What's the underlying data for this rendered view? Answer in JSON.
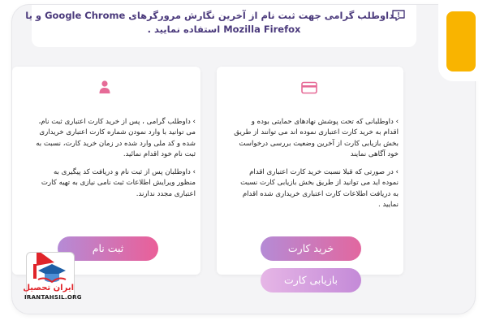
{
  "notice": {
    "line1": "داوطلب گرامی جهت ثبت نام از آخرین نگارش مرورگرهای Google Chrome و یا",
    "line2": "Mozilla Firefox استفاده نمایید ."
  },
  "register_card": {
    "icon": "user-icon",
    "para1": [
      "› داوطلب گرامی ، پس از خرید کارت اعتباری ثبت نام،",
      "می توانید با وارد نمودن شماره کارت اعتباری خریداری",
      "شده و کد ملی وارد شده در زمان خرید کارت، نسبت به",
      "ثبت نام خود اقدام نمائید."
    ],
    "para2": [
      "› داوطلبان پس از ثبت نام و دریافت کد پیگیری به",
      "منظور ویرایش اطلاعات ثبت نامی نیازی به تهیه کارت",
      "اعتباری مجدد ندارند."
    ],
    "button_label": "ثبت نام"
  },
  "purchase_card": {
    "icon": "credit-card-icon",
    "para1": [
      "› داوطلبانی که تحت پوشش نهادهای حمایتی بوده و",
      "اقدام به خرید کارت اعتباری نموده اند می توانند از طریق",
      "بخش بازیابی کارت از آخرین وضعیت بررسی درخواست",
      "خود آگاهی نمایند"
    ],
    "para2": [
      "› در صورتی که قبلا نسبت خرید کارت اعتباری اقدام",
      "نموده اید می توانید از طریق بخش بازیابی کارت نسبت",
      "به دریافت اطلاعات کارت اعتباری خریداری شده اقدام",
      "نمایید ."
    ],
    "buy_button_label": "خرید کارت",
    "recover_button_label": "بازیابی کارت"
  },
  "logo": {
    "brand_text": "ایران تحصیل",
    "url_text": "IRANTAHSIL.ORG"
  },
  "colors": {
    "accent_yellow": "#f9b400",
    "icon_pink": "#e66b97",
    "button_pink": "#ea5f98",
    "button_purple": "#b58bd6",
    "notice_text": "#4b3a7c",
    "logo_red": "#e0242a",
    "logo_blue": "#1f5fa6"
  }
}
